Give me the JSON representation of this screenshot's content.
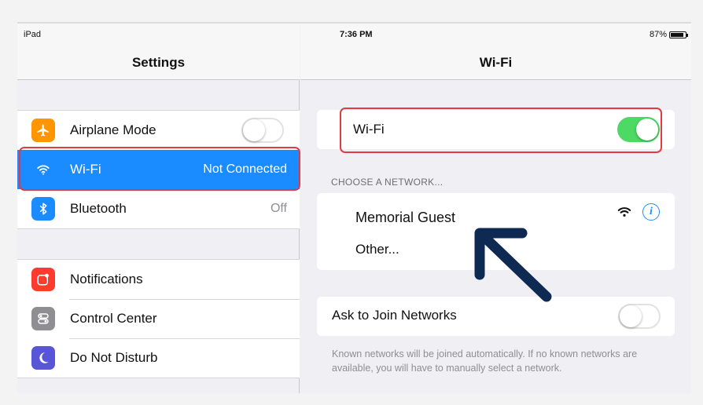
{
  "status_bar": {
    "device": "iPad",
    "time": "7:36 PM",
    "battery": "87%",
    "battery_level": 0.87
  },
  "left_pane": {
    "title": "Settings",
    "group1": [
      {
        "label": "Airplane Mode",
        "icon": "airplane-icon",
        "color": "#ff9500",
        "control": "toggle-off"
      },
      {
        "label": "Wi-Fi",
        "icon": "wifi-icon",
        "color": "#1a8cff",
        "value": "Not Connected",
        "selected": true
      },
      {
        "label": "Bluetooth",
        "icon": "bluetooth-icon",
        "color": "#1a8cff",
        "value": "Off"
      }
    ],
    "group2": [
      {
        "label": "Notifications",
        "icon": "notifications-icon",
        "color": "#ff3b30"
      },
      {
        "label": "Control Center",
        "icon": "control-center-icon",
        "color": "#8e8e93"
      },
      {
        "label": "Do Not Disturb",
        "icon": "moon-icon",
        "color": "#5856d6"
      }
    ]
  },
  "right_pane": {
    "title": "Wi-Fi",
    "wifi_row": {
      "label": "Wi-Fi",
      "toggle": "on"
    },
    "section_header": "CHOOSE A NETWORK...",
    "networks": [
      {
        "label": "Memorial Guest",
        "icons": [
          "wifi-signal-icon",
          "info-icon"
        ]
      },
      {
        "label": "Other..."
      }
    ],
    "ask_to_join": {
      "label": "Ask to Join Networks",
      "toggle": "off"
    },
    "footer": "Known networks will be joined automatically. If no known networks are available, you will have to manually select a network."
  },
  "colors": {
    "accent": "#1a8cff",
    "toggle_on": "#4cd964",
    "highlight_box": "#e23a44",
    "arrow": "#0f2a52"
  }
}
